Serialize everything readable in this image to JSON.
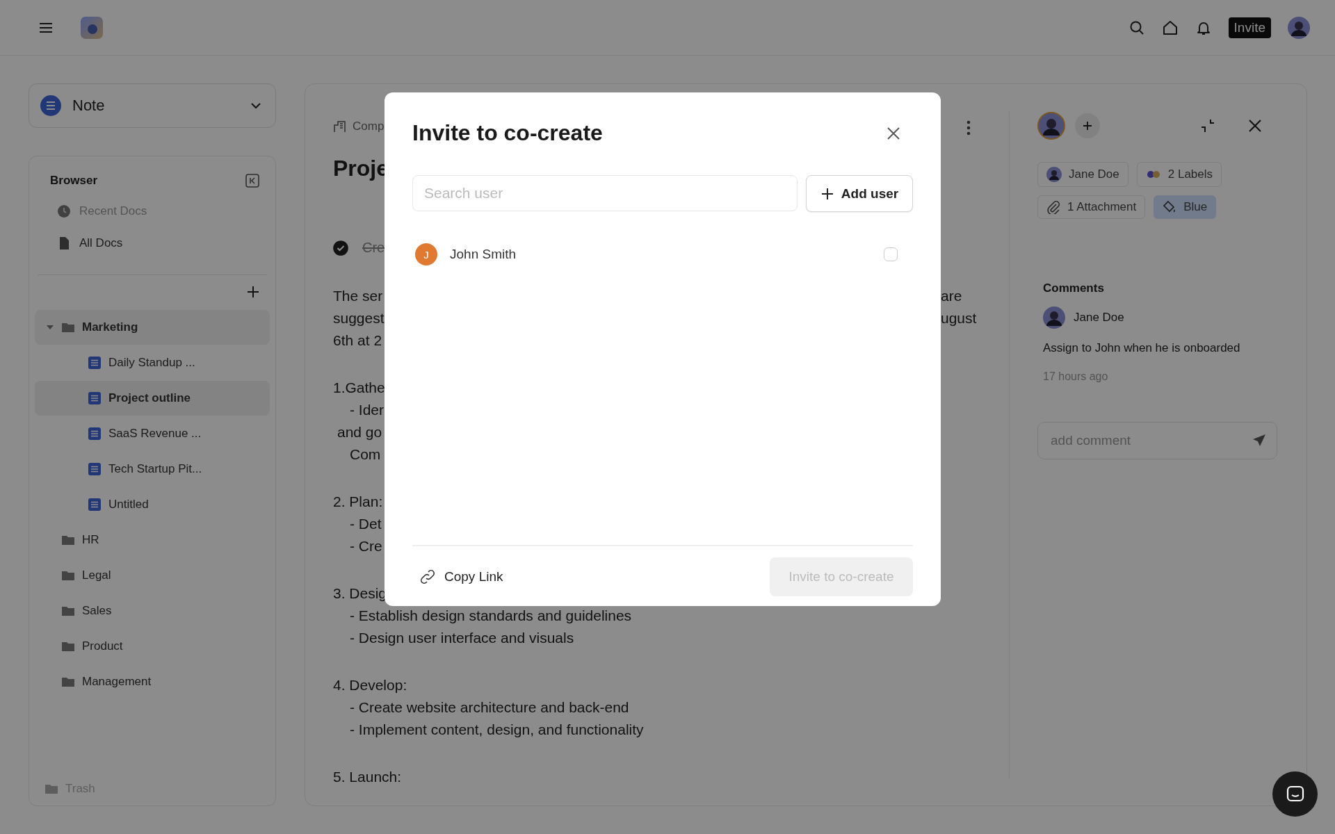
{
  "topbar": {
    "invite_button": "Invite"
  },
  "sidebar": {
    "note_selector": {
      "label": "Note"
    },
    "browser": {
      "title": "Browser",
      "nav": [
        {
          "label": "Recent Docs",
          "kind": "recent",
          "disabled": true
        },
        {
          "label": "All Docs",
          "kind": "all",
          "disabled": false
        }
      ],
      "tree": [
        {
          "label": "Marketing",
          "kind": "folder",
          "expanded": true,
          "children": [
            {
              "label": "Daily Standup ...",
              "kind": "doc",
              "selected": false
            },
            {
              "label": "Project outline",
              "kind": "doc",
              "selected": true
            },
            {
              "label": "SaaS Revenue ...",
              "kind": "doc",
              "selected": false
            },
            {
              "label": "Tech Startup Pit...",
              "kind": "doc",
              "selected": false
            },
            {
              "label": "Untitled",
              "kind": "doc",
              "selected": false
            }
          ]
        },
        {
          "label": "HR",
          "kind": "folder",
          "expanded": false
        },
        {
          "label": "Legal",
          "kind": "folder",
          "expanded": false
        },
        {
          "label": "Sales",
          "kind": "folder",
          "expanded": false
        },
        {
          "label": "Product",
          "kind": "folder",
          "expanded": false
        },
        {
          "label": "Management",
          "kind": "folder",
          "expanded": false
        }
      ],
      "trash": {
        "label": "Trash"
      }
    }
  },
  "document": {
    "breadcrumb": "Comp",
    "title": "Proje",
    "task": {
      "text": "Cre",
      "checked": true
    },
    "blocks": [
      {
        "lines": [
          {
            "text": "The ser",
            "right": "are",
            "kind": "plain"
          },
          {
            "text": "suggest",
            "right": "ugust",
            "kind": "plain"
          },
          {
            "text": "6th at 2",
            "kind": "plain"
          }
        ]
      },
      {
        "lines": [
          {
            "text": "1.Gathe",
            "kind": "plain"
          },
          {
            "text": "- Ider",
            "kind": "indent"
          },
          {
            "text": "and go",
            "kind": "wrap"
          },
          {
            "text": "Com",
            "kind": "indent"
          }
        ]
      },
      {
        "lines": [
          {
            "text": "2. Plan:",
            "kind": "plain"
          },
          {
            "text": "- Det",
            "kind": "indent"
          },
          {
            "text": "- Cre",
            "kind": "indent"
          }
        ]
      },
      {
        "lines": [
          {
            "text": "3. Desig",
            "kind": "plain"
          },
          {
            "text": "- Establish design standards and guidelines",
            "kind": "indent"
          },
          {
            "text": "- Design user interface and visuals",
            "kind": "indent"
          }
        ]
      },
      {
        "lines": [
          {
            "text": "4. Develop:",
            "kind": "plain"
          },
          {
            "text": "- Create website architecture and back-end",
            "kind": "indent"
          },
          {
            "text": "- Implement content, design, and functionality",
            "kind": "indent"
          }
        ]
      },
      {
        "lines": [
          {
            "text": "5. Launch:",
            "kind": "plain"
          }
        ]
      }
    ]
  },
  "details": {
    "chips": [
      {
        "label": "Jane Doe",
        "kind": "person",
        "selected": false
      },
      {
        "label": "2 Labels",
        "kind": "labels",
        "selected": false
      },
      {
        "label": "1 Attachment",
        "kind": "attachment",
        "selected": false
      },
      {
        "label": "Blue",
        "kind": "color",
        "selected": true
      }
    ],
    "comments": {
      "title": "Comments",
      "items": [
        {
          "author": "Jane Doe",
          "text": "Assign to John when he is onboarded",
          "time": "17 hours ago"
        }
      ]
    },
    "comment_field": {
      "placeholder": "add comment"
    }
  },
  "modal": {
    "title": "Invite to co-create",
    "search": {
      "placeholder": "Search user"
    },
    "add_button": "Add user",
    "users": [
      {
        "initial": "J",
        "name": "John Smith",
        "checked": false
      }
    ],
    "copy_link": "Copy Link",
    "invite_button": {
      "label": "Invite to co-create",
      "disabled": true
    }
  }
}
